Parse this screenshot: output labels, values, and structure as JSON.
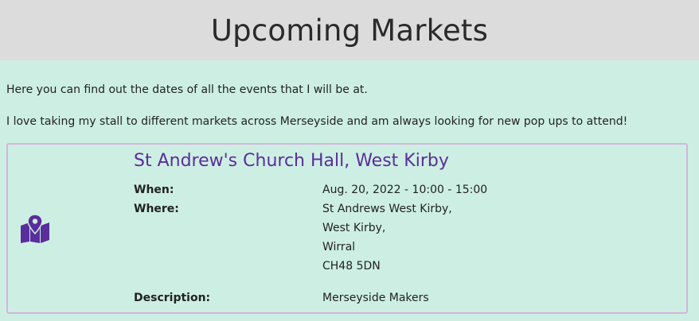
{
  "header": {
    "title": "Upcoming Markets"
  },
  "intro": {
    "line1": "Here you can find out the dates of all the events that I will be at.",
    "line2": "I love taking my stall to different markets across Merseyside and am always looking for new pop ups to attend!"
  },
  "events": [
    {
      "icon": "map-location-icon",
      "title": "St Andrew's Church Hall, West Kirby",
      "when_label": "When:",
      "when_value": "Aug. 20, 2022 - 10:00 - 15:00",
      "where_label": "Where:",
      "address": [
        "St Andrews West Kirby,",
        "West Kirby,",
        "Wirral",
        "CH48 5DN"
      ],
      "description_label": "Description:",
      "description_value": "Merseyside Makers"
    }
  ],
  "colors": {
    "header_bg": "#dcdcdc",
    "page_bg": "#cdefe3",
    "accent_purple": "#5a2d9c",
    "card_border": "#d6b4dc"
  }
}
